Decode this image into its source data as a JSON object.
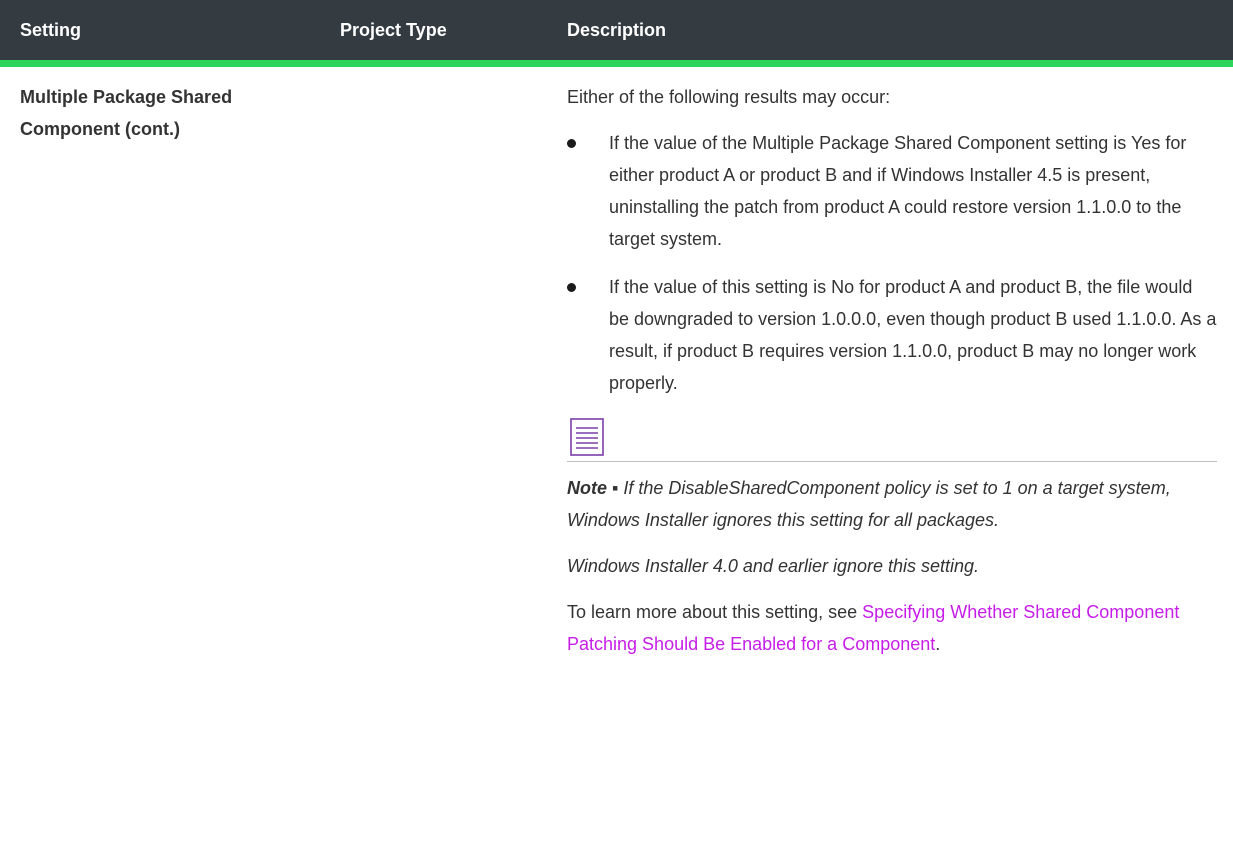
{
  "table": {
    "headers": {
      "setting": "Setting",
      "project_type": "Project Type",
      "description": "Description"
    },
    "row": {
      "setting_name": "Multiple Package Shared Component (cont.)",
      "intro": "Either of the following results may occur:",
      "bullets": [
        "If the value of the Multiple Package Shared Component setting is Yes for either product A or product B and if Windows Installer 4.5 is present, uninstalling the patch from product A could restore version 1.1.0.0 to the target system.",
        "If the value of this setting is No for product A and product B, the file would be downgraded to version 1.0.0.0, even though product B used 1.1.0.0. As a result, if product B requires version 1.1.0.0, product B may no longer work properly."
      ],
      "note_icon": "note-icon",
      "note_label": "Note ▪",
      "note_text": "If the DisableSharedComponent policy is set to 1 on a target system, Windows Installer ignores this setting for all packages.",
      "note_extra": "Windows Installer 4.0 and earlier ignore this setting.",
      "learn_more_prefix": "To learn more about this setting, see ",
      "learn_more_link": "Specifying Whether Shared Component Patching Should Be Enabled for a Component",
      "learn_more_suffix": "."
    }
  },
  "colors": {
    "header_bg": "#343b41",
    "header_accent": "#2fd45d",
    "link": "#c61ee8"
  }
}
